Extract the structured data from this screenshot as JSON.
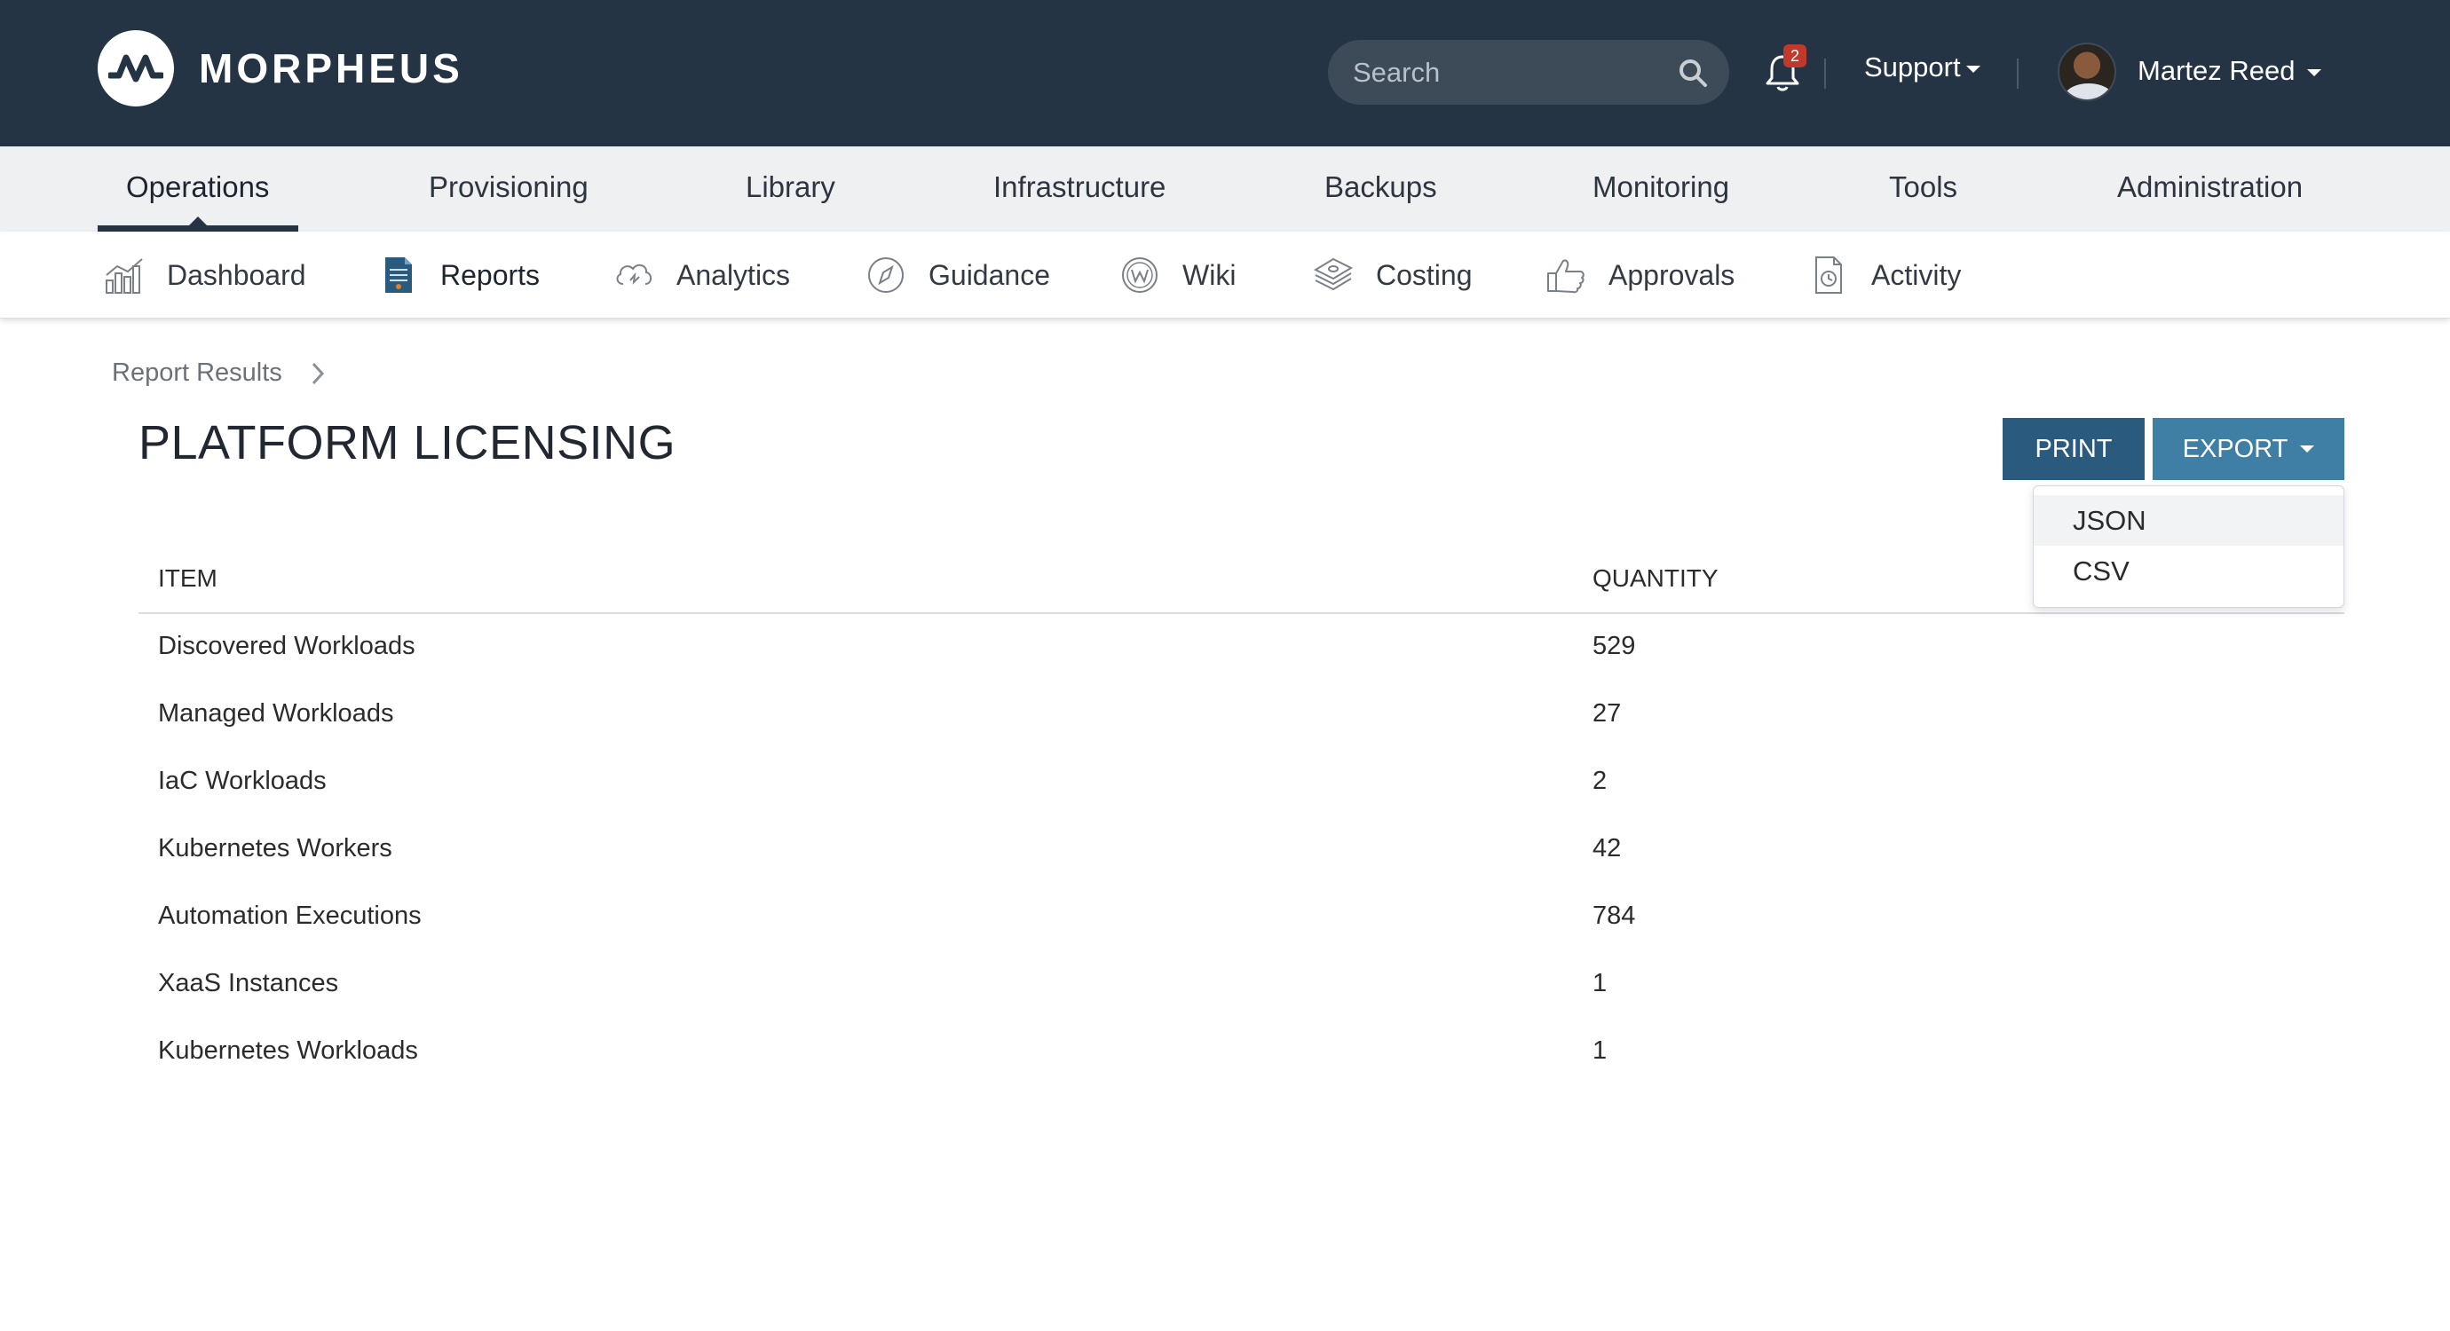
{
  "header": {
    "brand": "MORPHEUS",
    "search_placeholder": "Search",
    "notification_count": "2",
    "support_label": "Support",
    "user_name": "Martez Reed"
  },
  "primary_nav": {
    "items": [
      {
        "label": "Operations",
        "active": true
      },
      {
        "label": "Provisioning"
      },
      {
        "label": "Library"
      },
      {
        "label": "Infrastructure"
      },
      {
        "label": "Backups"
      },
      {
        "label": "Monitoring"
      },
      {
        "label": "Tools"
      },
      {
        "label": "Administration"
      }
    ]
  },
  "secondary_nav": {
    "items": [
      {
        "label": "Dashboard",
        "icon": "dashboard-chart-icon"
      },
      {
        "label": "Reports",
        "icon": "report-document-icon",
        "active": true
      },
      {
        "label": "Analytics",
        "icon": "cloud-analytics-icon"
      },
      {
        "label": "Guidance",
        "icon": "compass-icon"
      },
      {
        "label": "Wiki",
        "icon": "wiki-icon"
      },
      {
        "label": "Costing",
        "icon": "money-stack-icon"
      },
      {
        "label": "Approvals",
        "icon": "thumbs-up-icon"
      },
      {
        "label": "Activity",
        "icon": "activity-document-icon"
      }
    ]
  },
  "breadcrumb": {
    "label": "Report Results"
  },
  "page": {
    "title": "PLATFORM LICENSING",
    "print_label": "PRINT",
    "export_label": "EXPORT",
    "export_options": [
      "JSON",
      "CSV"
    ]
  },
  "table": {
    "headers": [
      "ITEM",
      "QUANTITY"
    ],
    "rows": [
      {
        "item": "Discovered Workloads",
        "quantity": "529"
      },
      {
        "item": "Managed Workloads",
        "quantity": "27"
      },
      {
        "item": "IaC Workloads",
        "quantity": "2"
      },
      {
        "item": "Kubernetes Workers",
        "quantity": "42"
      },
      {
        "item": "Automation Executions",
        "quantity": "784"
      },
      {
        "item": "XaaS Instances",
        "quantity": "1"
      },
      {
        "item": "Kubernetes Workloads",
        "quantity": "1"
      }
    ]
  },
  "colors": {
    "header_bg": "#253444",
    "print_button": "#2a5b7f",
    "export_button": "#3f7fa6",
    "badge": "#c0392b"
  }
}
